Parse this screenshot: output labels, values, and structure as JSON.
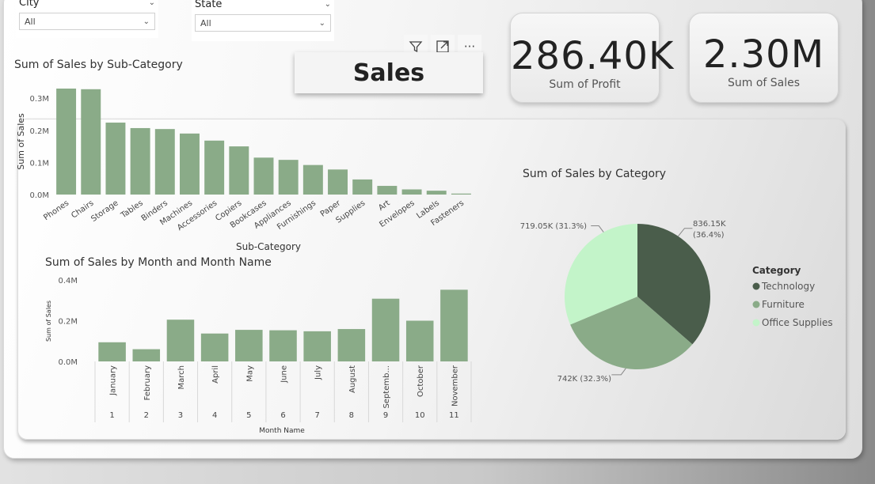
{
  "slicers": {
    "city": {
      "label": "City",
      "value": "All"
    },
    "state": {
      "label": "State",
      "value": "All"
    }
  },
  "report_title": "Sales",
  "cards": {
    "profit": {
      "value": "286.40K",
      "label": "Sum of Profit"
    },
    "sales": {
      "value": "2.30M",
      "label": "Sum of Sales"
    }
  },
  "visual_header_icons": [
    "filter-icon",
    "focus-mode-icon",
    "more-options-icon"
  ],
  "colors": {
    "bar": "#8aab88",
    "technology": "#4a5d4b",
    "furniture": "#8aab88",
    "office_supplies": "#c3f4c9"
  },
  "chart_data": [
    {
      "type": "bar",
      "title": "Sum of Sales by Sub-Category",
      "xlabel": "Sub-Category",
      "ylabel": "Sum of Sales",
      "yticks": [
        "0.0M",
        "0.1M",
        "0.2M",
        "0.3M"
      ],
      "ylim": [
        0,
        0.33
      ],
      "categories": [
        "Phones",
        "Chairs",
        "Storage",
        "Tables",
        "Binders",
        "Machines",
        "Accessories",
        "Copiers",
        "Bookcases",
        "Appliances",
        "Furnishings",
        "Paper",
        "Supplies",
        "Art",
        "Envelopes",
        "Labels",
        "Fasteners"
      ],
      "values": [
        0.33,
        0.328,
        0.224,
        0.207,
        0.204,
        0.19,
        0.168,
        0.15,
        0.115,
        0.108,
        0.092,
        0.078,
        0.047,
        0.027,
        0.016,
        0.012,
        0.003
      ]
    },
    {
      "type": "bar",
      "title": "Sum of Sales by Month and Month Name",
      "xlabel": "Month Name",
      "ylabel": "Sum of Sales",
      "yticks": [
        "0.0M",
        "0.2M",
        "0.4M"
      ],
      "ylim": [
        0,
        0.4
      ],
      "categories": [
        "January",
        "February",
        "March",
        "April",
        "May",
        "June",
        "July",
        "August",
        "Septemb...",
        "October",
        "November"
      ],
      "month_numbers": [
        "1",
        "2",
        "3",
        "4",
        "5",
        "6",
        "7",
        "8",
        "9",
        "10",
        "11"
      ],
      "values": [
        0.094,
        0.06,
        0.205,
        0.137,
        0.155,
        0.153,
        0.148,
        0.159,
        0.308,
        0.2,
        0.352
      ]
    },
    {
      "type": "pie",
      "title": "Sum of Sales by Category",
      "legend_title": "Category",
      "legend_position": "right",
      "categories": [
        "Technology",
        "Furniture",
        "Office Supplies"
      ],
      "values": [
        836.15,
        742,
        719.05
      ],
      "data_labels": [
        "836.15K (36.4%)",
        "742K (32.3%)",
        "719.05K (31.3%)"
      ]
    }
  ]
}
